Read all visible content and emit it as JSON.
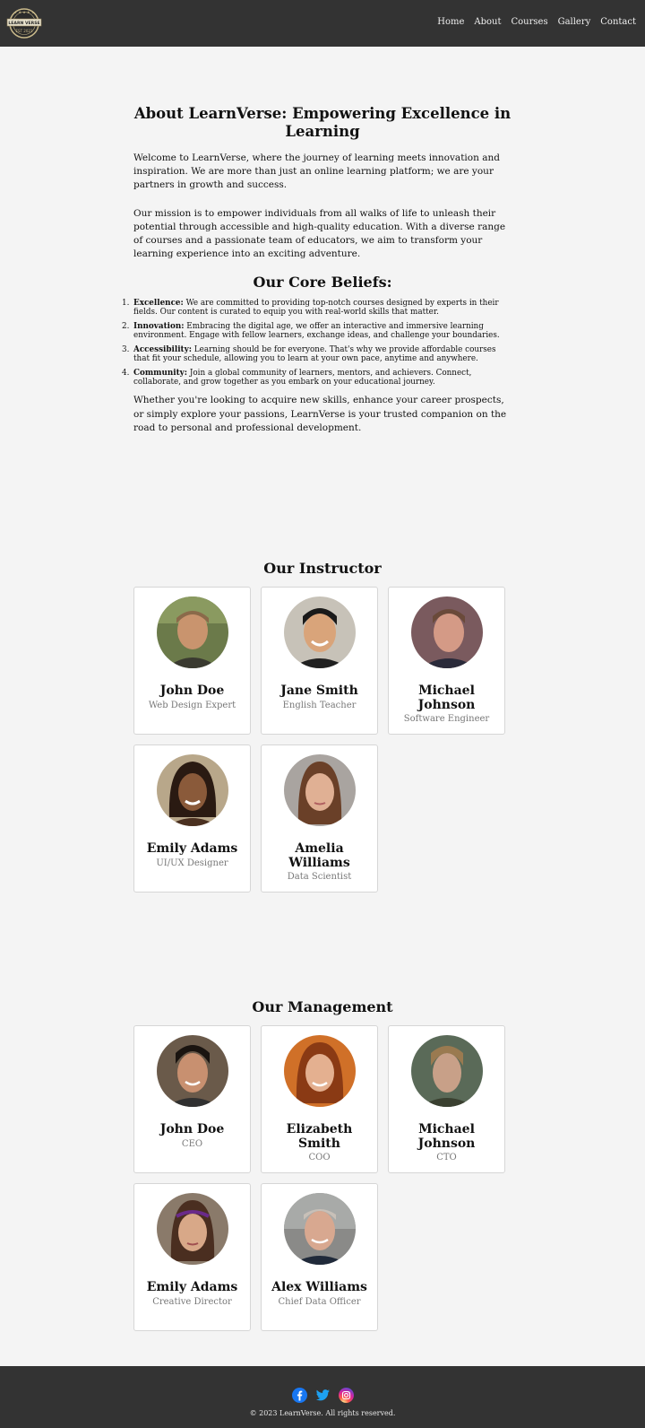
{
  "header": {
    "logo_text_top": "LEARN VERSE",
    "logo_text_bottom": "EST 2023",
    "nav": [
      "Home",
      "About",
      "Courses",
      "Gallery",
      "Contact"
    ]
  },
  "about": {
    "title": "About LearnVerse: Empowering Excellence in Learning",
    "intro": "Welcome to LearnVerse, where the journey of learning meets innovation and inspiration. We are more than just an online learning platform; we are your partners in growth and success.",
    "mission": "Our mission is to empower individuals from all walks of life to unleash their potential through accessible and high-quality education. With a diverse range of courses and a passionate team of educators, we aim to transform your learning experience into an exciting adventure.",
    "beliefs_title": "Our Core Beliefs:",
    "beliefs": [
      {
        "num": "1.",
        "term": "Excellence:",
        "text": " We are committed to providing top-notch courses designed by experts in their fields. Our content is curated to equip you with real-world skills that matter."
      },
      {
        "num": "2.",
        "term": "Innovation:",
        "text": " Embracing the digital age, we offer an interactive and immersive learning environment. Engage with fellow learners, exchange ideas, and challenge your boundaries."
      },
      {
        "num": "3.",
        "term": "Accessibility:",
        "text": " Learning should be for everyone. That's why we provide affordable courses that fit your schedule, allowing you to learn at your own pace, anytime and anywhere."
      },
      {
        "num": "4.",
        "term": "Community:",
        "text": " Join a global community of learners, mentors, and achievers. Connect, collaborate, and grow together as you embark on your educational journey."
      }
    ],
    "closing": "Whether you're looking to acquire new skills, enhance your career prospects, or simply explore your passions, LearnVerse is your trusted companion on the road to personal and professional development."
  },
  "instructors": {
    "title": "Our Instructor",
    "people": [
      {
        "name": "John Doe",
        "role": "Web Design Expert"
      },
      {
        "name": "Jane Smith",
        "role": "English Teacher"
      },
      {
        "name": "Michael Johnson",
        "role": "Software Engineer"
      },
      {
        "name": "Emily Adams",
        "role": "UI/UX Designer"
      },
      {
        "name": "Amelia Williams",
        "role": "Data Scientist"
      }
    ]
  },
  "management": {
    "title": "Our Management",
    "people": [
      {
        "name": "John Doe",
        "role": "CEO"
      },
      {
        "name": "Elizabeth Smith",
        "role": "COO"
      },
      {
        "name": "Michael Johnson",
        "role": "CTO"
      },
      {
        "name": "Emily Adams",
        "role": "Creative Director"
      },
      {
        "name": "Alex Williams",
        "role": "Chief Data Officer"
      }
    ]
  },
  "footer": {
    "social_icons": [
      "facebook-icon",
      "twitter-icon",
      "instagram-icon"
    ],
    "copyright": "© 2023 LearnVerse. All rights reserved."
  },
  "colors": {
    "header_bg": "#333333",
    "page_bg": "#f4f4f4",
    "facebook": "#1877f2",
    "twitter": "#1da1f2",
    "instagram": "#d6249f"
  }
}
